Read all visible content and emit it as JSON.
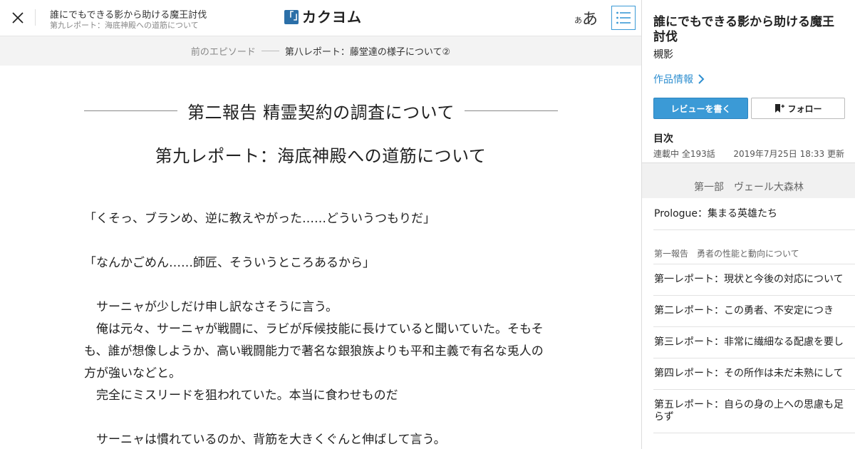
{
  "header": {
    "work_title": "誰にでもできる影から助ける魔王討伐",
    "episode_subtitle": "第九レポート：海底神殿への道筋について",
    "logo_mark": "「」",
    "logo_text": "カクヨム",
    "font_size_small": "あ",
    "font_size_large": "あ"
  },
  "prev_episode": {
    "label": "前のエピソード",
    "title": "第八レポート：藤堂達の様子について②"
  },
  "content": {
    "chapter_title": "第二報告 精霊契約の調査について",
    "episode_title": "第九レポート：海底神殿への道筋について",
    "paragraphs": [
      "「くそっ、ブランめ、逆に教えやがった……どういうつもりだ」",
      "",
      "「なんかごめん……師匠、そういうところあるから」",
      "",
      "　サーニャが少しだけ申し訳なさそうに言う。",
      "　俺は元々、サーニャが戦闘に、ラビが斥候技能に長けていると聞いていた。そもそも、誰が想像しようか、高い戦闘能力で著名な銀狼族よりも平和主義で有名な兎人の方が強いなどと。",
      "　完全にミスリードを狙われていた。本当に食わせものだ",
      "",
      "　サーニャは慣れているのか、背筋を大きくぐんと伸ばして言う。"
    ]
  },
  "sidebar": {
    "work_title": "誰にでもできる影から助ける魔王討伐",
    "author": "槻影",
    "info_link": "作品情報",
    "review_button": "レビューを書く",
    "follow_button": "フォロー",
    "toc_label": "目次",
    "status": "連載中 全193話",
    "updated": "2019年7月25日 18:33 更新",
    "part_title": "第一部　ヴェール大森林",
    "prologue": "Prologue：集まる英雄たち",
    "section_title": "第一報告　勇者の性能と動向について",
    "episodes": [
      "第一レポート：現状と今後の対応について",
      "第二レポート：この勇者、不安定につき",
      "第三レポート：非常に繊細なる配慮を要し",
      "第四レポート：その所作は未だ未熟にして",
      "第五レポート：自らの身の上への思慮も足らず"
    ]
  },
  "colors": {
    "accent": "#3b9ad6",
    "link": "#2f8fd0",
    "logo": "#2b6fa8"
  }
}
